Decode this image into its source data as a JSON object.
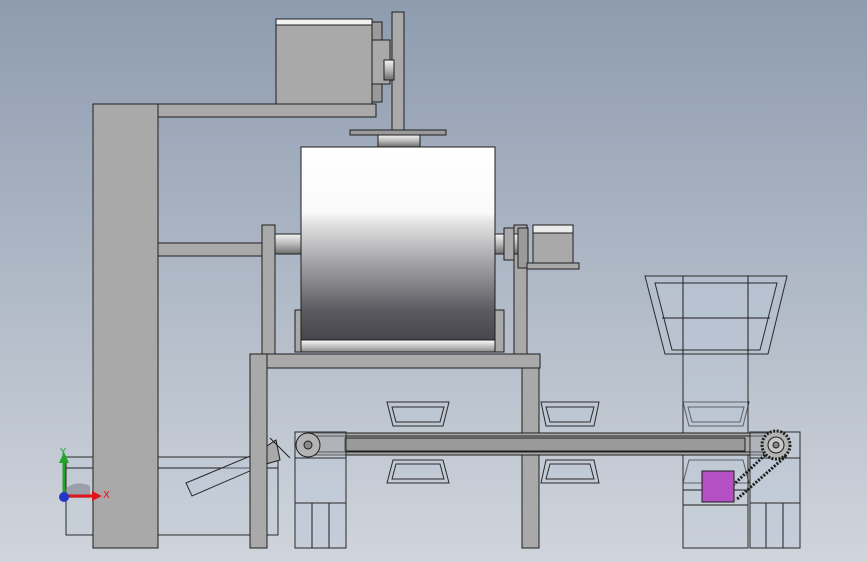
{
  "viewport": {
    "background_top": "#8e9cb0",
    "background_bottom": "#d0d5dc"
  },
  "triad": {
    "x_label": "X",
    "y_label": "Y",
    "x_color": "#e0161a",
    "y_color": "#22a42a",
    "z_color": "#2436c8"
  },
  "colors": {
    "steel_light": "#a9a9a9",
    "steel_dark": "#9a9a9a",
    "edge": "#1e1e1e",
    "motor_box": "#b44fc4"
  }
}
